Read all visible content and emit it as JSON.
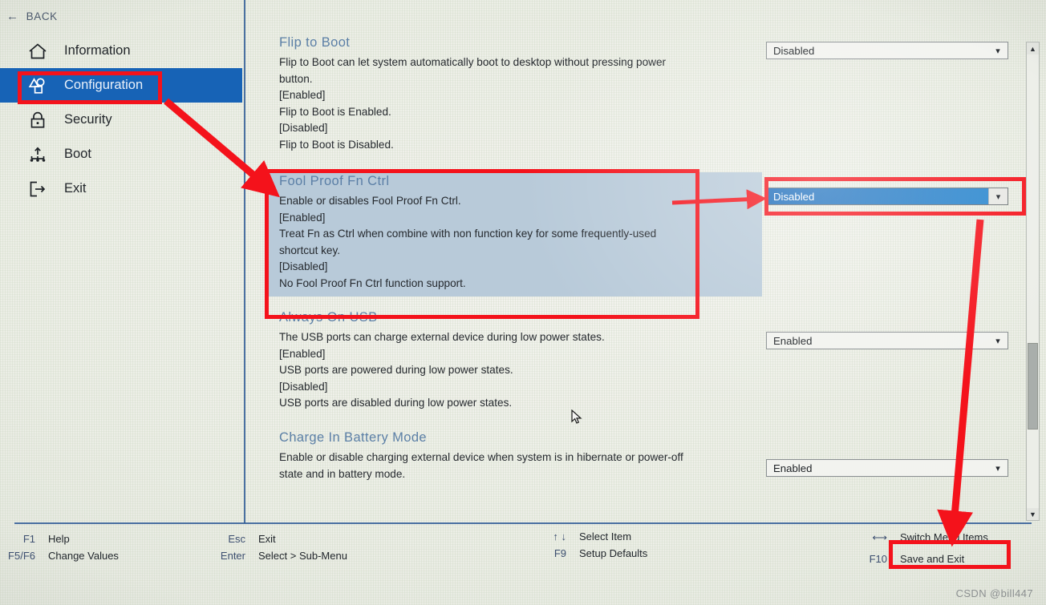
{
  "nav": {
    "back_label": "BACK",
    "back_icon": "arrow-left-icon",
    "items": [
      {
        "label": "Information",
        "icon": "home-icon",
        "selected": false
      },
      {
        "label": "Configuration",
        "icon": "config-shapes-icon",
        "selected": true
      },
      {
        "label": "Security",
        "icon": "lock-icon",
        "selected": false
      },
      {
        "label": "Boot",
        "icon": "boot-tree-icon",
        "selected": false
      },
      {
        "label": "Exit",
        "icon": "exit-door-icon",
        "selected": false
      }
    ]
  },
  "settings": [
    {
      "title": "Flip to Boot",
      "lines": [
        "Flip to Boot can let system automatically boot to desktop without pressing power",
        "button.",
        "[Enabled]",
        "Flip to Boot is Enabled.",
        "[Disabled]",
        "Flip to Boot is Disabled."
      ],
      "value": "Disabled",
      "highlighted": false,
      "active_value": false
    },
    {
      "title": "Fool Proof Fn Ctrl",
      "lines": [
        "Enable or disables Fool Proof Fn Ctrl.",
        "[Enabled]",
        "Treat Fn as Ctrl when combine with non function key for some frequently-used",
        "shortcut key.",
        "[Disabled]",
        "No Fool Proof Fn Ctrl function support."
      ],
      "value": "Disabled",
      "highlighted": true,
      "active_value": true
    },
    {
      "title": "Always On USB",
      "lines": [
        "The USB ports can charge external device during low power states.",
        "[Enabled]",
        "USB ports are powered during low power states.",
        "[Disabled]",
        "USB ports are disabled during low power states."
      ],
      "value": "Enabled",
      "highlighted": false,
      "active_value": false
    },
    {
      "title": "Charge In Battery Mode",
      "lines": [
        "Enable or disable charging external device when system is in hibernate or power-off",
        "state and in battery mode."
      ],
      "value": "Enabled",
      "highlighted": false,
      "active_value": false
    }
  ],
  "dropdown_caret_icon": "chevron-down-icon",
  "scrollbar": {
    "up_icon": "chevron-up-icon",
    "down_icon": "chevron-down-icon"
  },
  "legend": {
    "col1": [
      {
        "key": "F1",
        "action": "Help"
      },
      {
        "key": "F5/F6",
        "action": "Change Values"
      }
    ],
    "col2": [
      {
        "key": "Esc",
        "action": "Exit"
      },
      {
        "key": "Enter",
        "action": "Select > Sub-Menu"
      }
    ],
    "col3": [
      {
        "key": "↑ ↓",
        "action": "Select Item"
      },
      {
        "key": "F9",
        "action": "Setup Defaults"
      }
    ],
    "col4": [
      {
        "key": "⟷",
        "action": "Switch Menu Items"
      },
      {
        "key": "F10",
        "action": "Save and Exit"
      }
    ]
  },
  "watermark": "CSDN @bill447",
  "colors": {
    "accent_blue": "#1763b6",
    "rule_blue": "#2f5a97",
    "title_blue": "#5b7fa6",
    "highlight_row": "#b8cad9",
    "annotation_red": "#f4121b"
  }
}
